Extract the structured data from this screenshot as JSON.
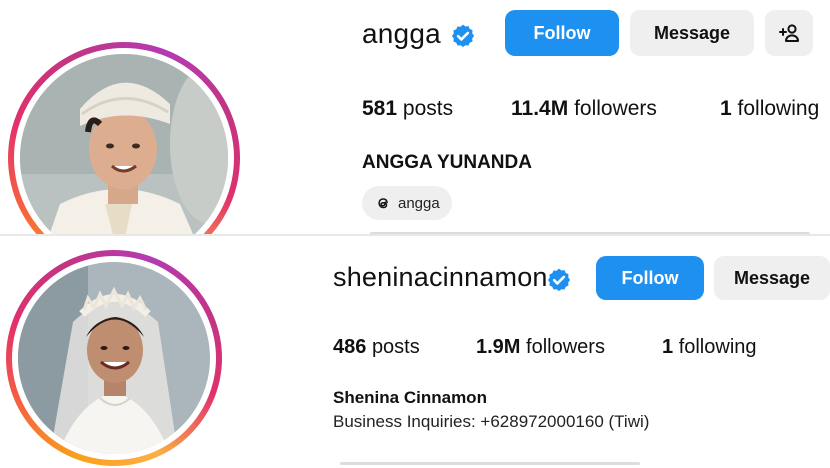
{
  "profiles": [
    {
      "username": "angga",
      "follow_label": "Follow",
      "message_label": "Message",
      "stats": {
        "posts_count": "581",
        "posts_label": "posts",
        "followers_count": "11.4M",
        "followers_label": "followers",
        "following_count": "1",
        "following_label": "following"
      },
      "full_name": "ANGGA YUNANDA",
      "threads_handle": "angga",
      "icons": [
        "verified-badge-icon",
        "add-person-icon",
        "threads-icon"
      ]
    },
    {
      "username": "sheninacinnamon",
      "follow_label": "Follow",
      "message_label": "Message",
      "stats": {
        "posts_count": "486",
        "posts_label": "posts",
        "followers_count": "1.9M",
        "followers_label": "followers",
        "following_count": "1",
        "following_label": "following"
      },
      "full_name": "Shenina Cinnamon",
      "bio": "Business Inquiries: +628972000160 (Tiwi)",
      "icons": [
        "verified-badge-icon"
      ]
    }
  ],
  "colors": {
    "follow_button": "#1e90f0",
    "secondary_button": "#efefef",
    "verified_badge": "#1e90f0"
  }
}
